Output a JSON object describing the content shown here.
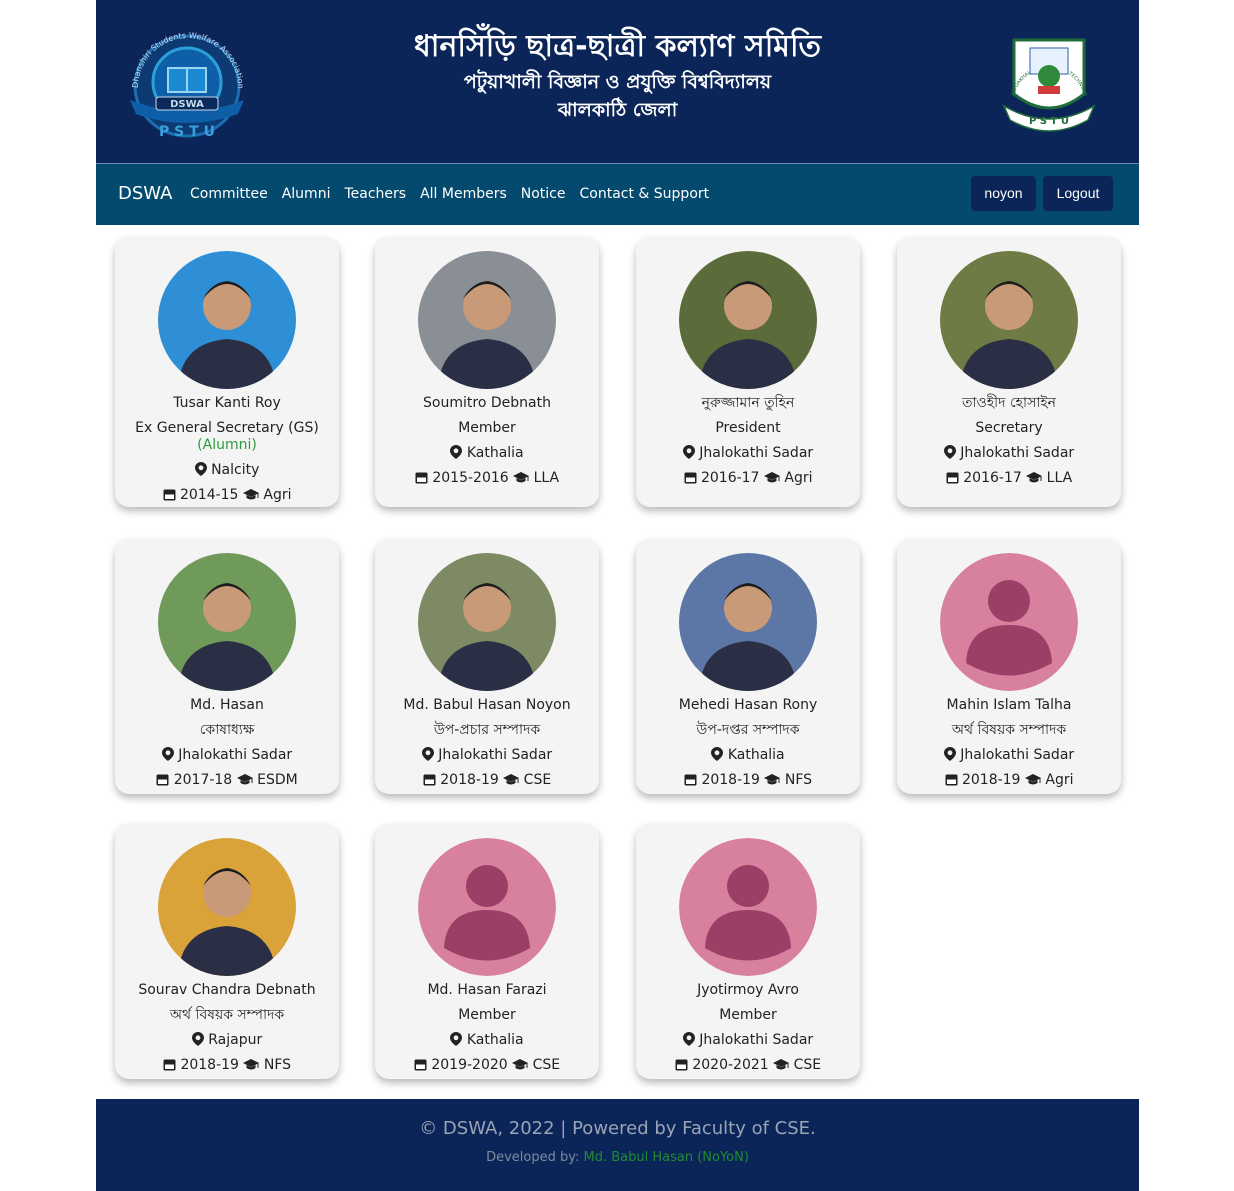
{
  "header": {
    "title": "ধানসিঁড়ি ছাত্র-ছাত্রী কল্যাণ সমিতি",
    "subtitle": "পটুয়াখালী বিজ্ঞান ও প্রযুক্তি বিশ্ববিদ্যালয়",
    "district": "ঝালকাঠি জেলা",
    "left_logo": {
      "ring_text": "Dhanshiri Students Welfare Association",
      "badge": "DSWA",
      "bottom": "P S T U"
    },
    "right_logo": {
      "ring_text": "PATUAKHALI SCIENCE AND TECHNOLOGY UNIVERSITY",
      "bottom": "P S T U"
    }
  },
  "nav": {
    "brand": "DSWA",
    "links": [
      "Committee",
      "Alumni",
      "Teachers",
      "All Members",
      "Notice",
      "Contact & Support"
    ],
    "user": "noyon",
    "logout": "Logout"
  },
  "members": [
    {
      "name": "Tusar Kanti Roy",
      "role": "Ex General Secretary (GS)",
      "note": "(Alumni)",
      "location": "Nalcity",
      "session": "2014-15",
      "dept": "Agri",
      "photo_color": "#2f8fd6"
    },
    {
      "name": "Soumitro Debnath",
      "role": "Member",
      "location": "Kathalia",
      "session": "2015-2016",
      "dept": "LLA",
      "photo_color": "#8a8f95"
    },
    {
      "name": "নুরুজ্জামান তুহিন",
      "role": "President",
      "location": "Jhalokathi Sadar",
      "session": "2016-17",
      "dept": "Agri",
      "photo_color": "#5b6b3a"
    },
    {
      "name": "তাওহীদ হোসাইন",
      "role": "Secretary",
      "location": "Jhalokathi Sadar",
      "session": "2016-17",
      "dept": "LLA",
      "photo_color": "#6f7b44"
    },
    {
      "name": "Md. Hasan",
      "role": "কোষাধ্যক্ষ",
      "location": "Jhalokathi Sadar",
      "session": "2017-18",
      "dept": "ESDM",
      "photo_color": "#6f9a5a"
    },
    {
      "name": "Md. Babul Hasan Noyon",
      "role": "উপ-প্রচার সম্পাদক",
      "location": "Jhalokathi Sadar",
      "session": "2018-19",
      "dept": "CSE",
      "photo_color": "#7d8a63"
    },
    {
      "name": "Mehedi Hasan Rony",
      "role": "উপ-দপ্তর সম্পাদক",
      "location": "Kathalia",
      "session": "2018-19",
      "dept": "NFS",
      "photo_color": "#5c77a6"
    },
    {
      "name": "Mahin Islam Talha",
      "role": "অর্থ বিষয়ক সম্পাদক",
      "location": "Jhalokathi Sadar",
      "session": "2018-19",
      "dept": "Agri",
      "photo_color": "placeholder"
    },
    {
      "name": "Sourav Chandra Debnath",
      "role": "অর্থ বিষয়ক সম্পাদক",
      "location": "Rajapur",
      "session": "2018-19",
      "dept": "NFS",
      "photo_color": "#d9a33a"
    },
    {
      "name": "Md. Hasan Farazi",
      "role": "Member",
      "location": "Kathalia",
      "session": "2019-2020",
      "dept": "CSE",
      "photo_color": "placeholder"
    },
    {
      "name": "Jyotirmoy Avro",
      "role": "Member",
      "location": "Jhalokathi Sadar",
      "session": "2020-2021",
      "dept": "CSE",
      "photo_color": "placeholder"
    }
  ],
  "footer": {
    "copyright": "© DSWA, 2022 | Powered by Faculty of CSE.",
    "dev_label": "Developed by:",
    "dev_name": "Md. Babul Hasan (NoYoN)"
  }
}
